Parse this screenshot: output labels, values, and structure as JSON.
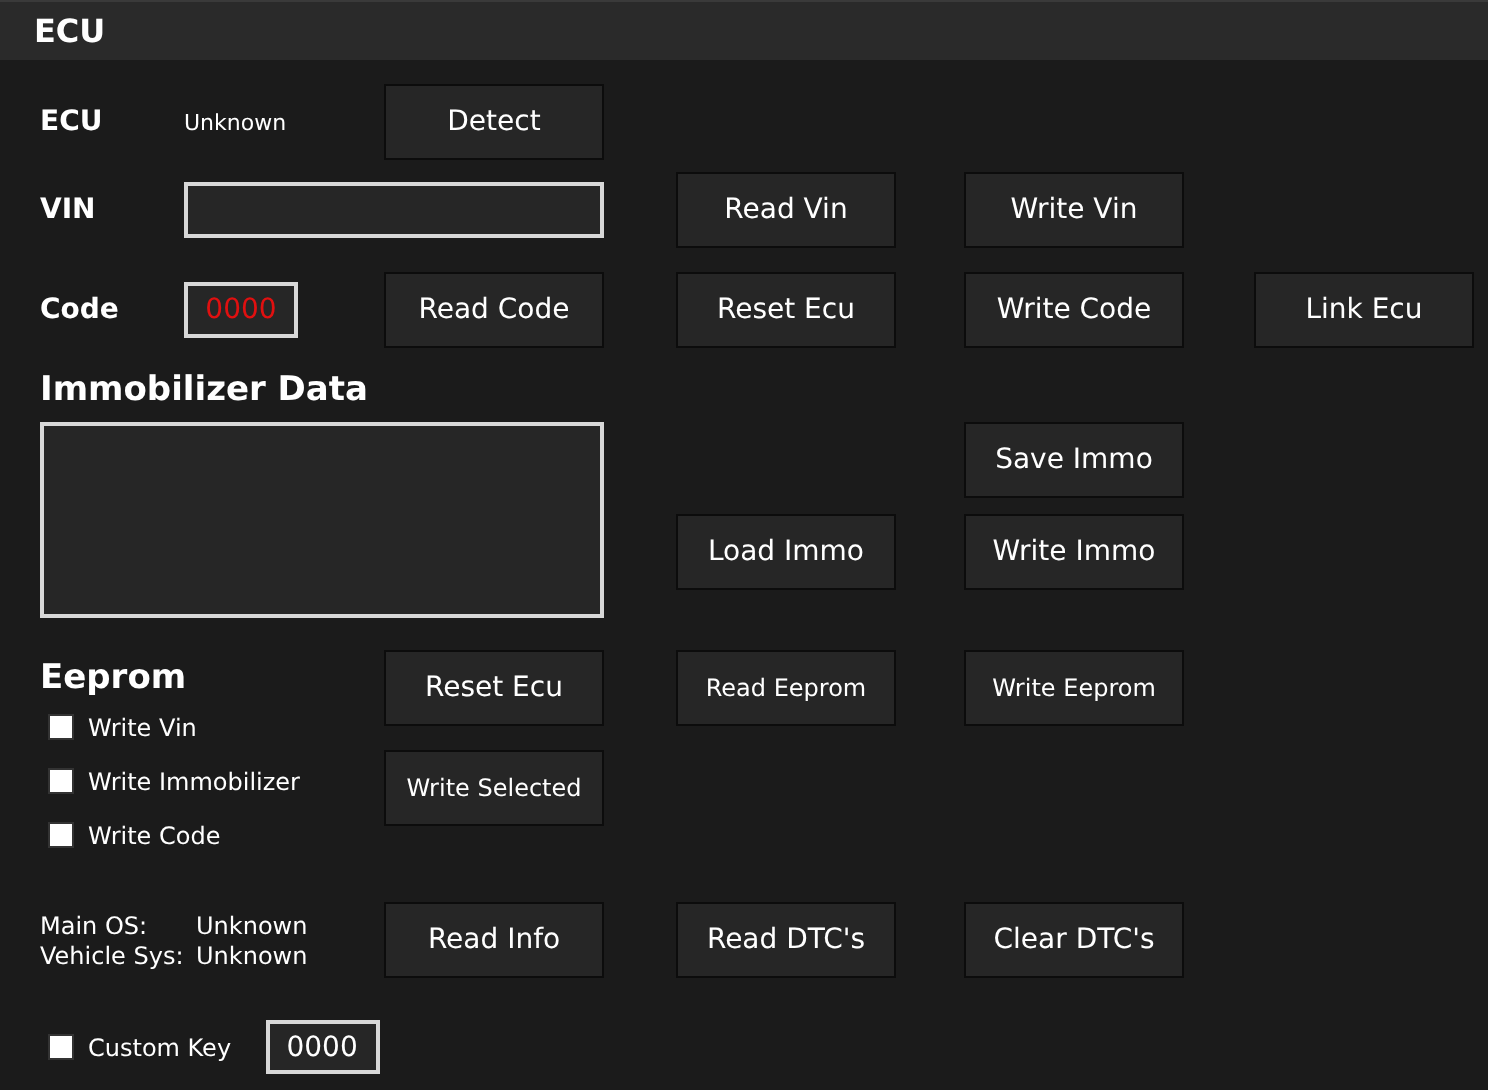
{
  "header": {
    "title": "ECU"
  },
  "ecu": {
    "label": "ECU",
    "value": "Unknown",
    "detect_button": "Detect"
  },
  "vin": {
    "label": "VIN",
    "buttons": [
      "Read Vin",
      "Write Vin"
    ]
  },
  "code": {
    "label": "Code",
    "value": "0000",
    "buttons": [
      "Read Code",
      "Reset Ecu",
      "Write Code",
      "Link Ecu"
    ]
  },
  "immobilizer": {
    "title": "Immobilizer Data",
    "buttons": [
      "Save Immo",
      "Load Immo",
      "Write Immo"
    ]
  },
  "eeprom": {
    "title": "Eeprom",
    "buttons": [
      "Reset Ecu",
      "Read Eeprom",
      "Write Eeprom",
      "Write Selected"
    ],
    "options": [
      {
        "label": "Write Vin",
        "checked": false
      },
      {
        "label": "Write Immobilizer",
        "checked": false
      },
      {
        "label": "Write Code",
        "checked": false
      }
    ]
  },
  "info": {
    "rows": [
      {
        "label": "Main OS:",
        "value": "Unknown"
      },
      {
        "label": "Vehicle Sys:",
        "value": "Unknown"
      }
    ],
    "buttons": [
      "Read Info",
      "Read DTC's",
      "Clear DTC's"
    ]
  },
  "custom_key": {
    "label": "Custom Key",
    "checked": false,
    "value": "0000"
  }
}
